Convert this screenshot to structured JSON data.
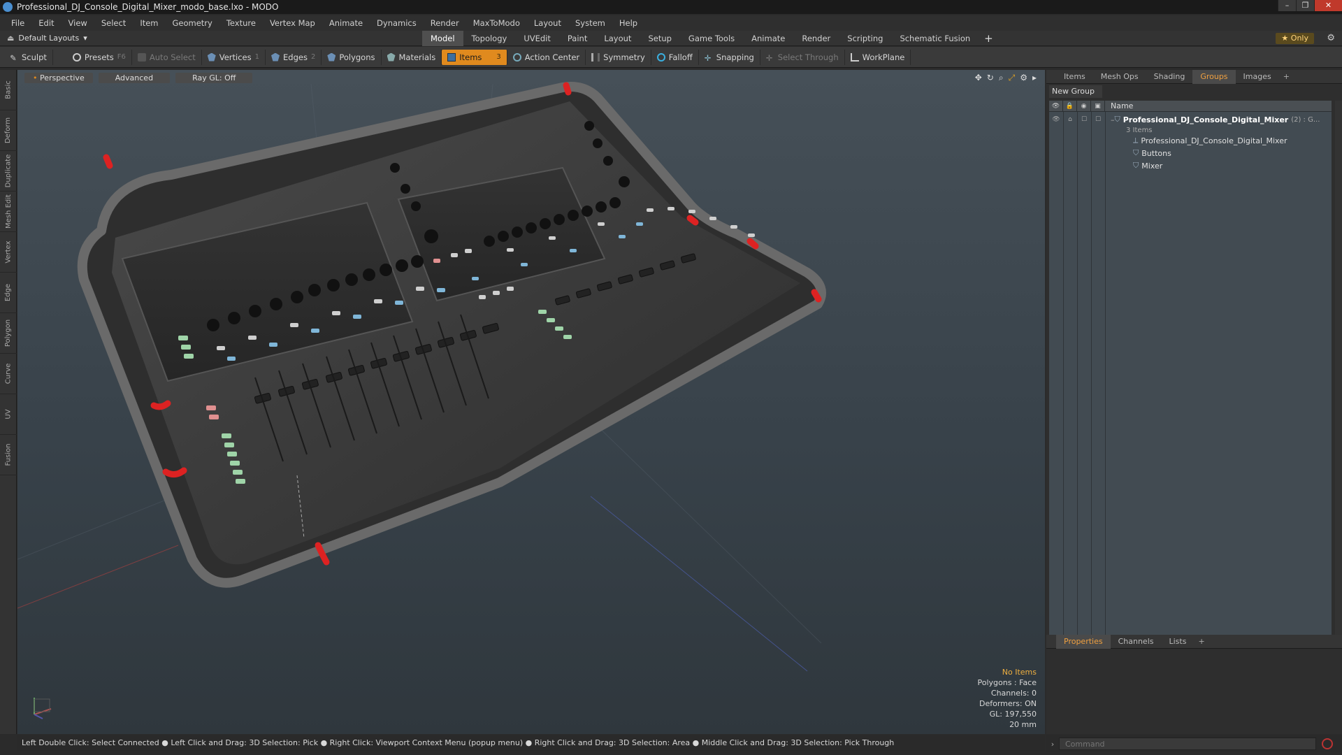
{
  "window": {
    "title": "Professional_DJ_Console_Digital_Mixer_modo_base.lxo - MODO",
    "controls": [
      "–",
      "❐",
      "✕"
    ]
  },
  "menu": [
    "File",
    "Edit",
    "View",
    "Select",
    "Item",
    "Geometry",
    "Texture",
    "Vertex Map",
    "Animate",
    "Dynamics",
    "Render",
    "MaxToModo",
    "Layout",
    "System",
    "Help"
  ],
  "layoutbar": {
    "layouts_label": "Default Layouts",
    "tabs": [
      "Model",
      "Topology",
      "UVEdit",
      "Paint",
      "Layout",
      "Setup",
      "Game Tools",
      "Animate",
      "Render",
      "Scripting",
      "Schematic Fusion"
    ],
    "active_tab": "Model",
    "add_tab": "+",
    "only_label": "Only"
  },
  "toolbar": {
    "sculpt": "Sculpt",
    "presets": "Presets",
    "presets_key": "F6",
    "auto_select": "Auto Select",
    "vertices": "Vertices",
    "vertices_count": "1",
    "edges": "Edges",
    "edges_count": "2",
    "polygons": "Polygons",
    "materials": "Materials",
    "items": "Items",
    "items_count": "3",
    "action_center": "Action Center",
    "symmetry": "Symmetry",
    "falloff": "Falloff",
    "snapping": "Snapping",
    "select_through": "Select Through",
    "workplane": "WorkPlane"
  },
  "left_tabs": [
    "Basic",
    "Deform",
    "Duplicate",
    "Mesh Edit",
    "Vertex",
    "Edge",
    "Polygon",
    "Curve",
    "UV",
    "Fusion"
  ],
  "viewport": {
    "view_mode": "Perspective",
    "shading": "Advanced",
    "ray_gl": "Ray GL: Off",
    "info": {
      "selection": "No Items",
      "polygons": "Polygons : Face",
      "channels": "Channels: 0",
      "deformers": "Deformers: ON",
      "gl": "GL: 197,550",
      "grid": "20 mm"
    }
  },
  "right_panel": {
    "tabs": [
      "Items",
      "Mesh Ops",
      "Shading",
      "Groups",
      "Images"
    ],
    "active_tab": "Groups",
    "new_group": "New Group",
    "column_name": "Name",
    "groups": [
      {
        "name": "Professional_DJ_Console_Digital_Mixer",
        "suffix": "(2) : G...",
        "sub": "3 Items",
        "level": 0
      },
      {
        "name": "Professional_DJ_Console_Digital_Mixer",
        "level": 1
      },
      {
        "name": "Buttons",
        "level": 1
      },
      {
        "name": "Mixer",
        "level": 1
      }
    ],
    "bottom_tabs": [
      "Properties",
      "Channels",
      "Lists"
    ],
    "bottom_active": "Properties",
    "command_placeholder": "Command"
  },
  "statusbar": {
    "text": "Left Double Click: Select Connected ● Left Click and Drag: 3D Selection: Pick ● Right Click: Viewport Context Menu (popup menu) ● Right Click and Drag: 3D Selection: Area ● Middle Click and Drag: 3D Selection: Pick Through"
  },
  "colors": {
    "accent": "#e08a1e",
    "active_tab_text": "#f0a040",
    "mixer_body": "#3a3a3a"
  }
}
